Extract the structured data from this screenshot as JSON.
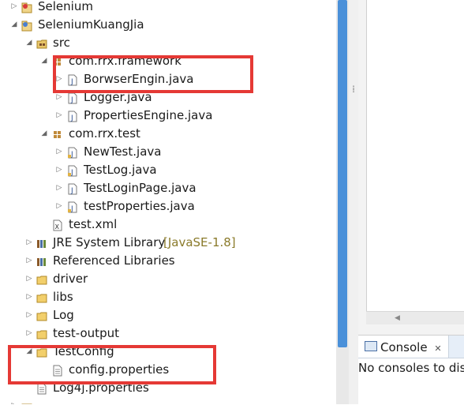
{
  "explorer": {
    "rows": [
      {
        "label": "Selenium",
        "icon": "project-icon",
        "expanded": false
      },
      {
        "label": "SeleniumKuangJia",
        "icon": "project-icon",
        "expanded": true
      },
      {
        "label": "src",
        "icon": "source-folder-icon",
        "expanded": true
      },
      {
        "label": "com.rrx.framework",
        "icon": "package-icon",
        "expanded": true
      },
      {
        "label": "BorwserEngin.java",
        "icon": "java-file-icon",
        "expanded": false
      },
      {
        "label": "Logger.java",
        "icon": "java-file-icon",
        "expanded": false
      },
      {
        "label": "PropertiesEngine.java",
        "icon": "java-file-icon",
        "expanded": false
      },
      {
        "label": "com.rrx.test",
        "icon": "package-icon",
        "expanded": true
      },
      {
        "label": "NewTest.java",
        "icon": "java-file-icon",
        "expanded": false
      },
      {
        "label": "TestLog.java",
        "icon": "java-file-icon",
        "expanded": false
      },
      {
        "label": "TestLoginPage.java",
        "icon": "java-file-icon",
        "expanded": false
      },
      {
        "label": "testProperties.java",
        "icon": "java-file-icon",
        "expanded": false
      },
      {
        "label": "test.xml",
        "icon": "xml-file-icon",
        "expanded": false
      },
      {
        "label": "JRE System Library",
        "decoration": "[JavaSE-1.8]",
        "icon": "library-icon",
        "expanded": false
      },
      {
        "label": "Referenced Libraries",
        "icon": "library-icon",
        "expanded": false
      },
      {
        "label": "driver",
        "icon": "folder-icon",
        "expanded": false
      },
      {
        "label": "libs",
        "icon": "folder-icon",
        "expanded": false
      },
      {
        "label": "Log",
        "icon": "folder-icon",
        "expanded": false
      },
      {
        "label": "test-output",
        "icon": "folder-icon",
        "expanded": false
      },
      {
        "label": "TestConfig",
        "icon": "folder-icon",
        "expanded": true
      },
      {
        "label": "config.properties",
        "icon": "properties-file-icon",
        "expanded": false
      },
      {
        "label": "Log4j.properties",
        "icon": "properties-file-icon",
        "expanded": false
      }
    ]
  },
  "splitter": {
    "grip": "⁞"
  },
  "console": {
    "tab_label": "Console",
    "close_glyph": "✕",
    "message": "No consoles to dis"
  },
  "colors": {
    "highlight_box": "#e53935",
    "scroll_thumb": "#4a90d9"
  }
}
